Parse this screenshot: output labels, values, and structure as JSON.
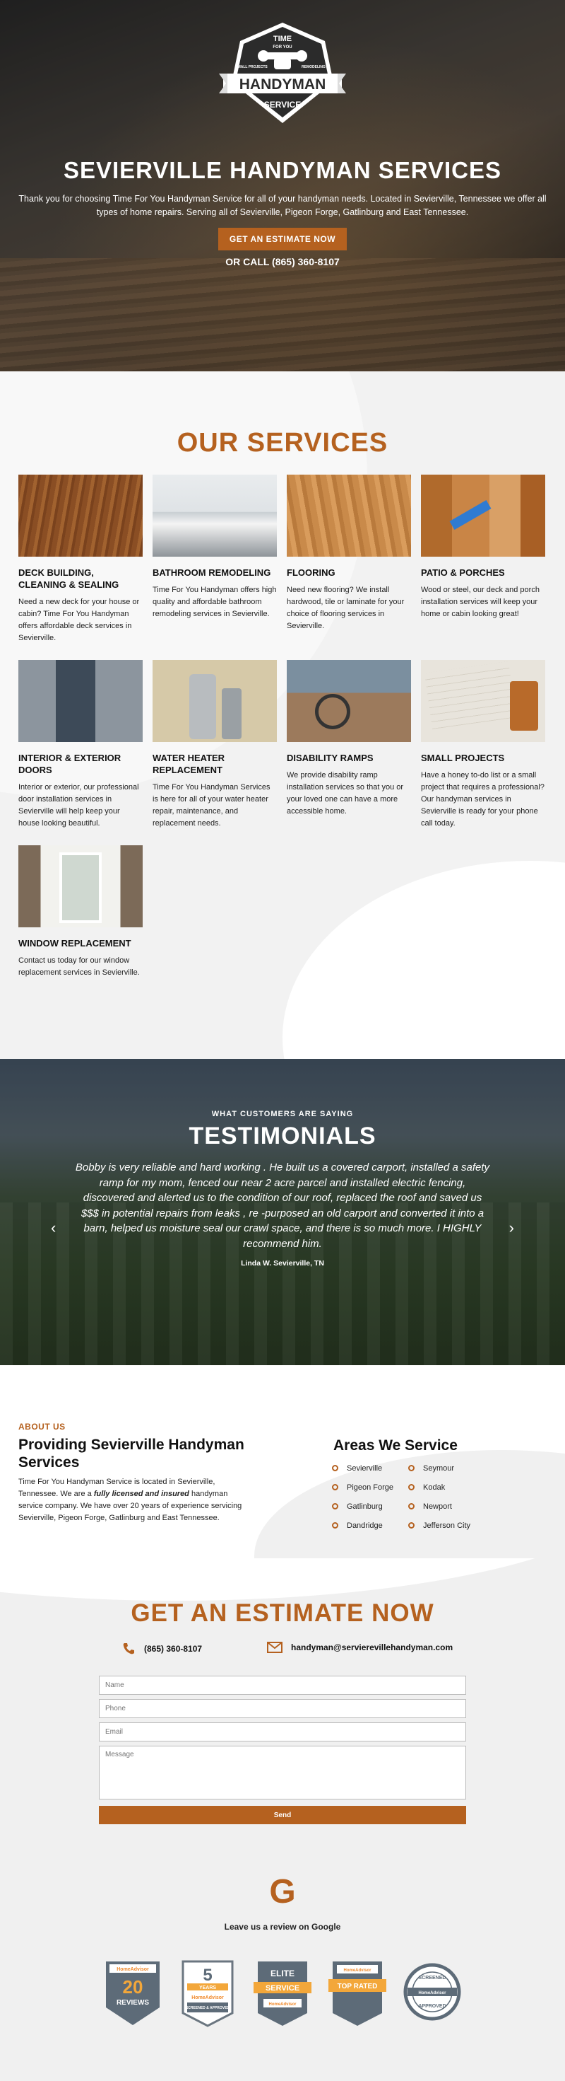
{
  "hero": {
    "logo": {
      "line1": "TIME",
      "line2": "FOR YOU",
      "left_ribbon": "SMALL PROJECTS",
      "right_ribbon": "REMODELING",
      "main": "HANDYMAN",
      "bottom": "SERVICE",
      "icon": "fist-wrench-icon"
    },
    "title": "SEVIERVILLE HANDYMAN SERVICES",
    "intro": "Thank you for choosing Time For You Handyman Service for all of your handyman needs. Located in Sevierville, Tennessee we offer all types of home repairs. Serving all of Sevierville, Pigeon Forge, Gatlinburg and East Tennessee.",
    "cta_label": "GET AN ESTIMATE NOW",
    "call_text": "OR CALL (865) 360-8107"
  },
  "services": {
    "heading": "OUR SERVICES",
    "items": [
      {
        "title": "DECK BUILDING, CLEANING & SEALING",
        "text": "Need a new deck for your house or cabin? Time For You Handyman offers affordable deck services in Sevierville.",
        "image": "deck-photo"
      },
      {
        "title": "BATHROOM REMODELING",
        "text": "Time For You Handyman offers high quality and affordable bathroom remodeling services in Sevierville.",
        "image": "bathroom-photo"
      },
      {
        "title": "FLOORING",
        "text": "Need new flooring? We install hardwood, tile or laminate for your choice of flooring services in Sevierville.",
        "image": "flooring-photo"
      },
      {
        "title": "PATIO & PORCHES",
        "text": "Wood or steel, our deck and porch installation services will keep your home or cabin looking great!",
        "image": "porch-painting-photo"
      },
      {
        "title": "INTERIOR & EXTERIOR DOORS",
        "text": "Interior or exterior, our professional door installation services in Sevierville will help keep your house looking beautiful.",
        "image": "door-photo"
      },
      {
        "title": "WATER HEATER REPLACEMENT",
        "text": "Time For You Handyman Services is here for all of your water heater repair, maintenance, and replacement needs.",
        "image": "water-heater-photo"
      },
      {
        "title": "DISABILITY RAMPS",
        "text": "We provide disability ramp installation services so that you or your loved one can have a more accessible home.",
        "image": "wheelchair-ramp-photo"
      },
      {
        "title": "SMALL PROJECTS",
        "text": "Have a honey to-do list or a small project that requires a professional? Our handyman services in Sevierville is ready for your phone call today.",
        "image": "tools-blueprint-photo"
      },
      {
        "title": "WINDOW REPLACEMENT",
        "text": "Contact us today for our window replacement services in Sevierville.",
        "image": "window-photo"
      }
    ]
  },
  "testimonials": {
    "kicker": "WHAT CUSTOMERS ARE SAYING",
    "heading": "TESTIMONIALS",
    "quote": "Bobby is very reliable and hard working . He built us a covered carport, installed a safety ramp for my mom, fenced our near 2 acre parcel and installed electric fencing, discovered and alerted us to the condition of our roof, replaced the roof and saved us $$$ in potential repairs from leaks , re -purposed an old carport and converted it into a barn, helped us moisture seal our crawl space, and there is so much more. I HIGHLY recommend him.",
    "author": "Linda W. Sevierville, TN",
    "prev_icon": "chevron-left-icon",
    "next_icon": "chevron-right-icon"
  },
  "about": {
    "kicker": "ABOUT US",
    "heading": "Providing Sevierville Handyman Services",
    "body_1": "Time For You Handyman Service is located in Sevierville, Tennessee. We are a ",
    "body_bold": "fully licensed and insured",
    "body_2": " handyman service company. We have over 20 years of experience servicing Sevierville, Pigeon Forge, Gatlinburg and East Tennessee.",
    "areas_heading": "Areas We Service",
    "areas": [
      "Sevierville",
      "Seymour",
      "Pigeon Forge",
      "Kodak",
      "Gatlinburg",
      "Newport",
      "Dandridge",
      "Jefferson City"
    ]
  },
  "estimate": {
    "heading": "GET AN ESTIMATE NOW",
    "phone": "(865) 360-8107",
    "email": "handyman@servierevillehandyman.com",
    "name_placeholder": "Name",
    "phone_placeholder": "Phone",
    "email_placeholder": "Email",
    "message_placeholder": "Message",
    "send_label": "Send"
  },
  "reviews": {
    "google_glyph": "G",
    "google_text": "Leave us a review on Google",
    "badges": [
      {
        "brand": "HomeAdvisor",
        "big": "20",
        "small": "REVIEWS"
      },
      {
        "big": "5",
        "small": "YEARS",
        "brand": "HomeAdvisor",
        "extra": "SCREENED & APPROVED"
      },
      {
        "big": "ELITE",
        "small": "SERVICE",
        "brand": "HomeAdvisor"
      },
      {
        "brand": "HomeAdvisor",
        "big": "TOP RATED",
        "small": ""
      },
      {
        "big": "SCREENED",
        "brand": "HomeAdvisor",
        "small": "APPROVED"
      }
    ]
  },
  "colors": {
    "accent": "#b5611f",
    "dark": "#222222",
    "light_bg": "#f0f0f0"
  }
}
